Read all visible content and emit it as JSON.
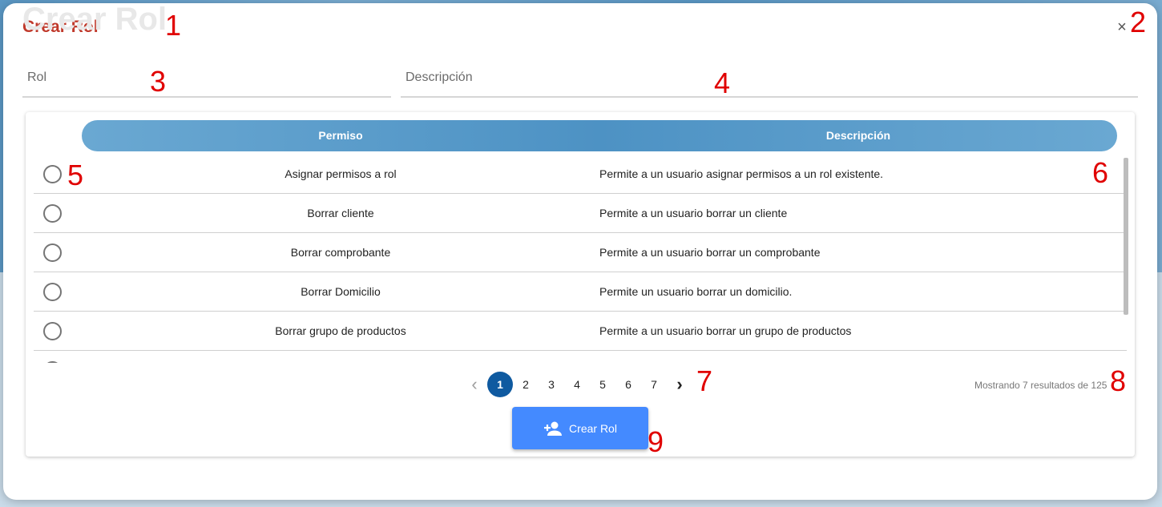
{
  "background": {
    "ghost_title": "Crear Rol"
  },
  "modal": {
    "title": "Crear Rol",
    "close_label": "×"
  },
  "form": {
    "rol_placeholder": "Rol",
    "descripcion_placeholder": "Descripción"
  },
  "table": {
    "columns": [
      "Permiso",
      "Descripción"
    ],
    "rows": [
      {
        "permiso": "Asignar permisos a rol",
        "descripcion": "Permite a un usuario asignar permisos a un rol existente.",
        "selected": false
      },
      {
        "permiso": "Borrar cliente",
        "descripcion": "Permite a un usuario borrar un cliente",
        "selected": false
      },
      {
        "permiso": "Borrar comprobante",
        "descripcion": "Permite a un usuario borrar un comprobante",
        "selected": false
      },
      {
        "permiso": "Borrar Domicilio",
        "descripcion": "Permite un usuario borrar un domicilio.",
        "selected": false
      },
      {
        "permiso": "Borrar grupo de productos",
        "descripcion": "Permite a un usuario borrar un grupo de productos",
        "selected": false
      }
    ]
  },
  "pagination": {
    "prev_icon": "chevron-left-icon",
    "next_icon": "chevron-right-icon",
    "pages": [
      "1",
      "2",
      "3",
      "4",
      "5",
      "6",
      "7"
    ],
    "current_page": "1",
    "result_text": "Mostrando 7 resultados de 125"
  },
  "actions": {
    "create_label": "Crear Rol",
    "create_icon": "person-add-icon",
    "create_color": "#448aff"
  },
  "annotations": [
    "1",
    "2",
    "3",
    "4",
    "5",
    "6",
    "7",
    "8",
    "9"
  ],
  "colors": {
    "title": "#c0392b",
    "header_bg": "#4d92c4",
    "active_page": "#0f5aa0"
  }
}
